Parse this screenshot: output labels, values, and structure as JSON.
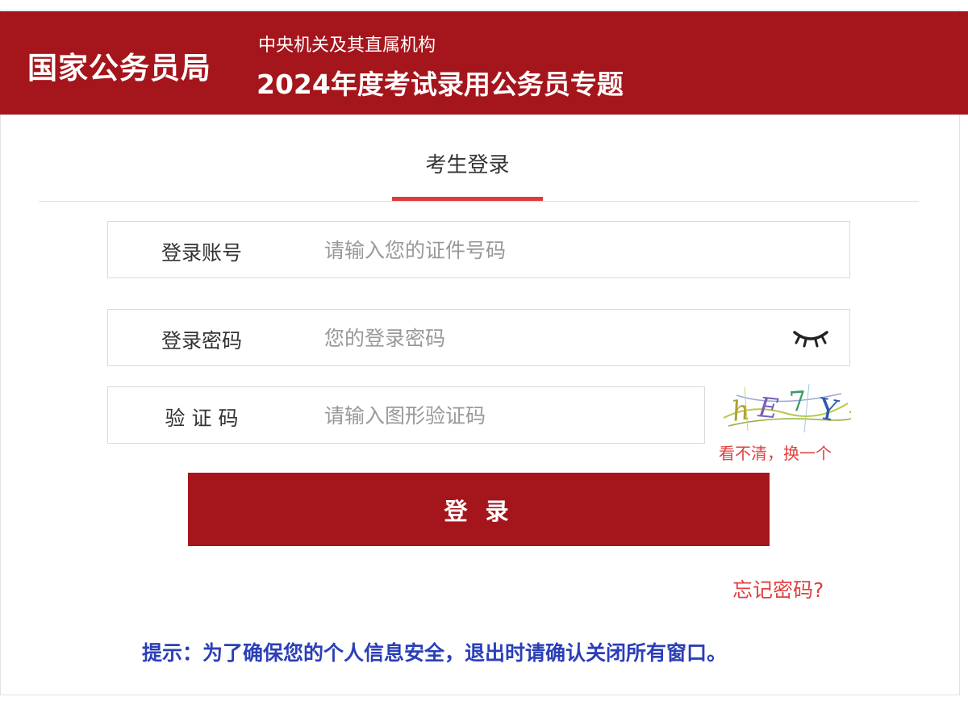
{
  "header": {
    "brand": "国家公务员局",
    "subtitle_top": "中央机关及其直属机构",
    "subtitle_main": "2024年度考试录用公务员专题"
  },
  "tab": {
    "label": "考生登录"
  },
  "form": {
    "account": {
      "label": "登录账号",
      "placeholder": "请输入您的证件号码",
      "value": ""
    },
    "password": {
      "label": "登录密码",
      "placeholder": "您的登录密码",
      "value": "",
      "toggle_icon": "eye-closed-icon"
    },
    "captcha": {
      "label": "验 证 码",
      "placeholder": "请输入图形验证码",
      "value": "",
      "image_text": "hE7Y",
      "refresh_label": "看不清，换一个"
    },
    "submit_label": "登 录",
    "forgot_label": "忘记密码?"
  },
  "notice": "提示：为了确保您的个人信息安全，退出时请确认关闭所有窗口。",
  "colors": {
    "brand_red": "#a5151c",
    "accent_red": "#e03a3a",
    "link_red": "#e04040",
    "notice_blue": "#2b3fb8"
  }
}
